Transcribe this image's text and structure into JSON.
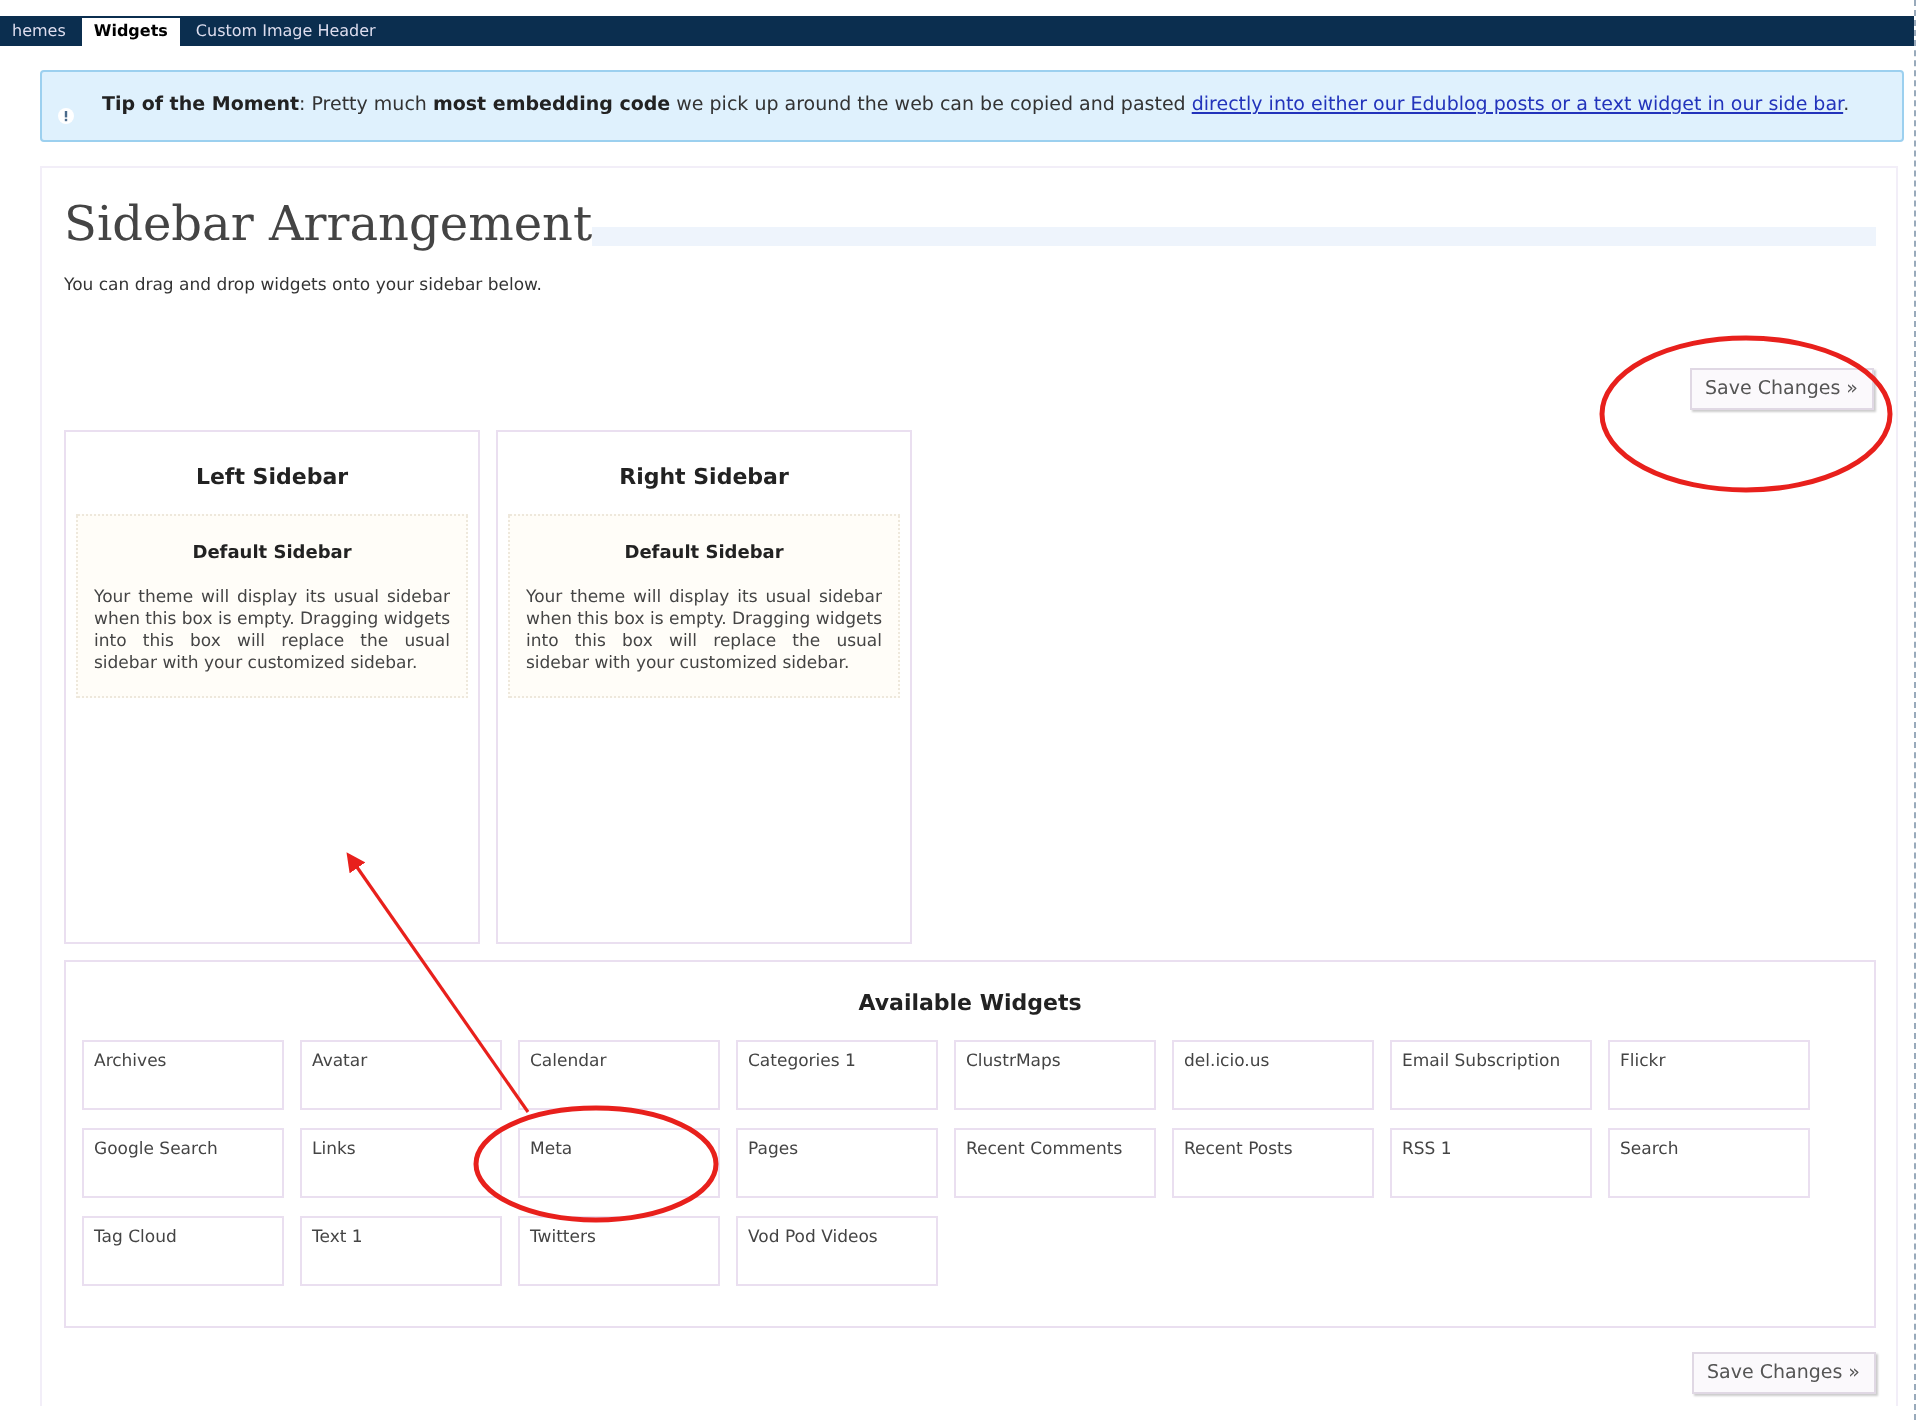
{
  "tabs": [
    {
      "label": "hemes",
      "selected": false
    },
    {
      "label": "Widgets",
      "selected": true
    },
    {
      "label": "Custom Image Header",
      "selected": false
    }
  ],
  "tip": {
    "text": "**Tip of the Moment**: Pretty much **most embedding code** we pick up around the web can be copied and pasted ",
    "link": "directly into either our Edublog posts or a text widget in our side bar",
    "end": "."
  },
  "title": "Sidebar Arrangement",
  "intro": "You can drag and drop widgets onto your sidebar below.",
  "save_button": "Save Changes »",
  "sidebars": [
    {
      "title": "Left Sidebar",
      "default_title": "Default Sidebar",
      "default_text": "Your theme will display its usual sidebar when this box is empty. Dragging widgets into this box will replace the usual sidebar with your customized sidebar."
    },
    {
      "title": "Right Sidebar",
      "default_title": "Default Sidebar",
      "default_text": "Your theme will display its usual sidebar when this box is empty. Dragging widgets into this box will replace the usual sidebar with your customized sidebar."
    }
  ],
  "available": {
    "title": "Available Widgets",
    "widgets": [
      "Archives",
      "Avatar",
      "Calendar",
      "Categories 1",
      "ClustrMaps",
      "del.icio.us",
      "Email Subscription",
      "Flickr",
      "Google Search",
      "Links",
      "Meta",
      "Pages",
      "Recent Comments",
      "Recent Posts",
      "RSS 1",
      "Search",
      "Tag Cloud",
      "Text 1",
      "Twitters",
      "Vod Pod Videos"
    ]
  },
  "bottom_save_button": "Save Changes »"
}
